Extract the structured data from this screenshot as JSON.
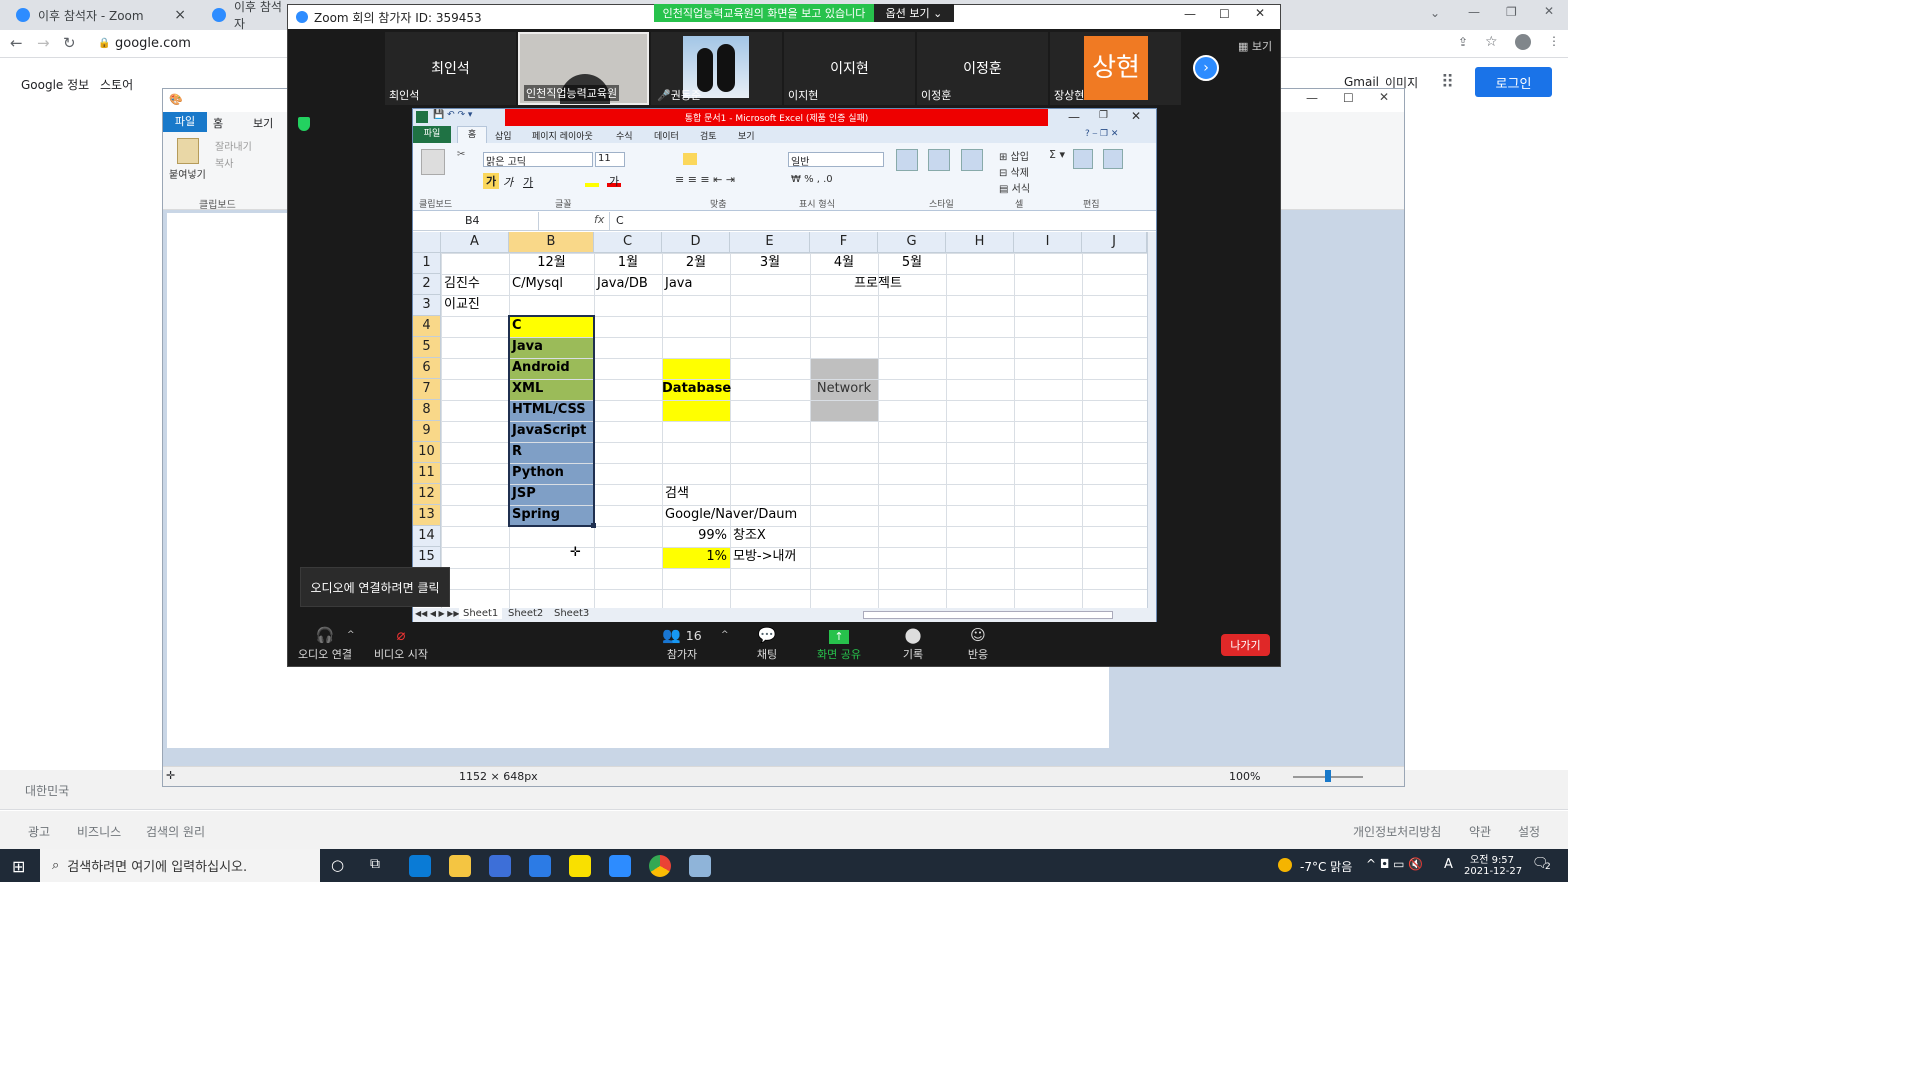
{
  "chrome": {
    "tabs": [
      "이후 참석자 - Zoom",
      "이후 참석자"
    ],
    "url": "google.com"
  },
  "google": {
    "top_left": [
      "Google 정보",
      "스토어"
    ],
    "top_right": [
      "Gmail",
      "이미지"
    ],
    "signin": "로그인",
    "country": "대한민국",
    "footer_left": [
      "광고",
      "비즈니스",
      "검색의 원리"
    ],
    "footer_right": [
      "개인정보처리방침",
      "약관",
      "설정"
    ]
  },
  "paint": {
    "tabs": [
      "파일",
      "홈",
      "보기"
    ],
    "ribbon": {
      "paste": "붙여넣기",
      "cut": "잘라내기",
      "copy": "복사",
      "group": "클립보드"
    },
    "status": {
      "size": "1152 × 648px",
      "zoom": "100%"
    }
  },
  "zoom": {
    "title": "Zoom 회의 참가자 ID: 359453",
    "share_banner": "인천직업능력교육원의 화면을 보고 있습니다",
    "view_options": "옵션 보기",
    "view_btn": "보기",
    "participants": [
      {
        "display": "최인석",
        "label": "최인석"
      },
      {
        "display": "",
        "label": "인천직업능력교육원"
      },
      {
        "display": "",
        "label": "권동준"
      },
      {
        "display": "이지현",
        "label": "이지현"
      },
      {
        "display": "이정훈",
        "label": "이정훈"
      },
      {
        "display": "상현",
        "label": "장상현"
      }
    ],
    "tooltip": "오디오에 연결하려면 클릭",
    "toolbar": [
      {
        "label": "오디오 연결",
        "icon": "headphone-icon"
      },
      {
        "label": "비디오 시작",
        "icon": "video-off-icon"
      },
      {
        "label": "참가자",
        "icon": "participants-icon",
        "count": "16"
      },
      {
        "label": "채팅",
        "icon": "chat-icon"
      },
      {
        "label": "화면 공유",
        "icon": "share-icon"
      },
      {
        "label": "기록",
        "icon": "record-icon"
      },
      {
        "label": "반응",
        "icon": "reaction-icon"
      }
    ],
    "leave": "나가기"
  },
  "excel": {
    "title": "통합 문서1 - Microsoft Excel (제품 인증 실패)",
    "menu": [
      "파일",
      "홈",
      "삽입",
      "페이지 레이아웃",
      "수식",
      "데이터",
      "검토",
      "보기"
    ],
    "font_name": "맑은 고딕",
    "font_size": "11",
    "number_format": "일반",
    "ribbon_groups": [
      "클립보드",
      "글꼴",
      "맞춤",
      "표시 형식",
      "스타일",
      "셀",
      "편집"
    ],
    "name_box": "B4",
    "formula": "C",
    "columns": [
      "A",
      "B",
      "C",
      "D",
      "E",
      "F",
      "G",
      "H",
      "I",
      "J"
    ],
    "rows": [
      "1",
      "2",
      "3",
      "4",
      "5",
      "6",
      "7",
      "8",
      "9",
      "10",
      "11",
      "12",
      "13",
      "14",
      "15"
    ],
    "cells": {
      "B1": "12월",
      "C1": "1월",
      "D1": "2월",
      "E1": "3월",
      "F1": "4월",
      "G1": "5월",
      "A2": "김진수",
      "B2": "C/Mysql",
      "C2": "Java/DB",
      "D2": "Java",
      "F2": "프로젝트",
      "A3": "이교진",
      "B4": "C",
      "B5": "Java",
      "B6": "Android",
      "B7": "XML",
      "B8": "HTML/CSS",
      "B9": "JavaScript",
      "B10": "R",
      "B11": "Python",
      "B12": "JSP",
      "B13": "Spring",
      "D7": "Database",
      "F7": "Network",
      "D12": "검색",
      "D13": "Google/Naver/Daum",
      "D14": "99%",
      "E14": "창조X",
      "D15": "1%",
      "E15": "모방->내꺼"
    },
    "sheets": [
      "Sheet1",
      "Sheet2",
      "Sheet3"
    ],
    "colors": {
      "yellow": "#ffff00",
      "green": "#9bbb59",
      "blue": "#7f9fc6",
      "gray": "#bfbfbf"
    }
  },
  "taskbar": {
    "search": "검색하려면 여기에 입력하십시오.",
    "weather": "-7°C 맑음",
    "time": "오전 9:57",
    "date": "2021-12-27",
    "ime": "A",
    "notifications": "2"
  }
}
